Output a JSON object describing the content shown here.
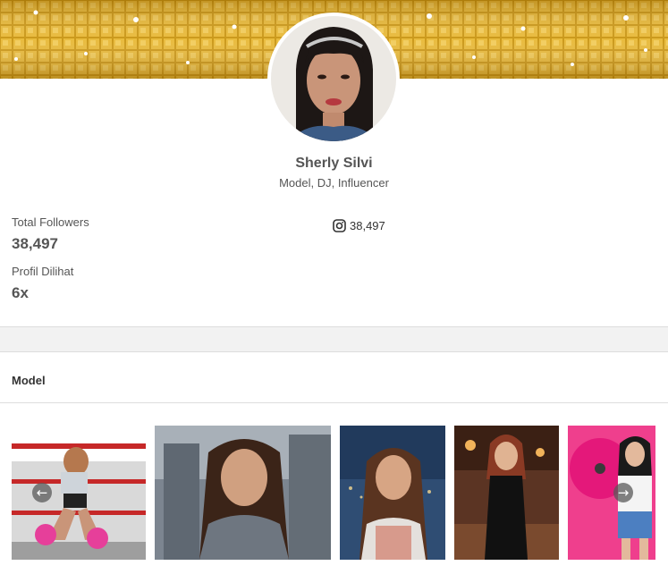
{
  "profile": {
    "name": "Sherly Silvi",
    "role": "Model, DJ, Influencer"
  },
  "stats": {
    "followers_label": "Total Followers",
    "followers_value": "38,497",
    "views_label": "Profil Dilihat",
    "views_value": "6x",
    "instagram_count": "38,497",
    "instagram_icon": "instagram-icon"
  },
  "section": {
    "title": "Model"
  },
  "gallery": {
    "prev_icon": "arrow-left-icon",
    "next_icon": "arrow-right-icon",
    "photos": [
      "photo-boxing-ring",
      "photo-grey-top",
      "photo-night-city",
      "photo-black-dress",
      "photo-pink-record"
    ]
  },
  "colors": {
    "banner_gold": "#e0a92a",
    "text_gray": "#555555",
    "divider": "#dddddd",
    "band": "#f2f2f2"
  }
}
